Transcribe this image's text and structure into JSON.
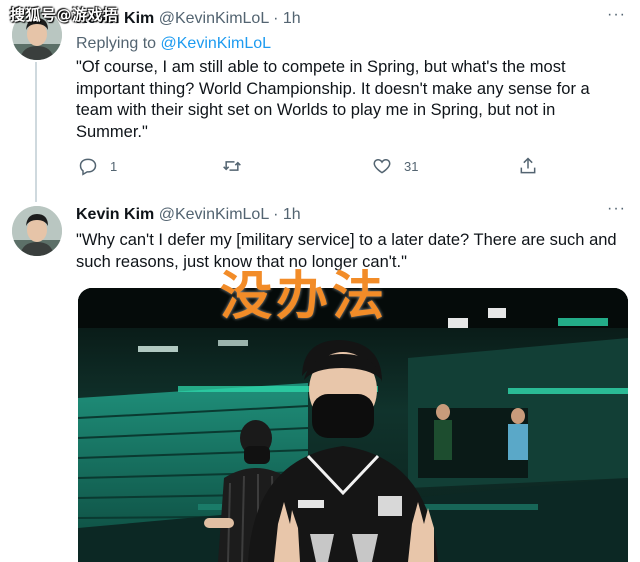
{
  "watermark": "搜狐号@游戏捂",
  "overlay_text": "没办法",
  "tweets": [
    {
      "name": "Kevin Kim",
      "handle": "@KevinKimLoL",
      "dot": "·",
      "time": "1h",
      "more": "···",
      "reply_prefix": "Replying to",
      "reply_mention": "@KevinKimLoL",
      "text": "\"Of course, I am still able to compete in Spring, but what's the most important thing? World Championship. It doesn't make any sense for a team with their sight set on Worlds to play me in Spring, but not in Summer.\"",
      "replies": "1",
      "retweets": "",
      "likes": "31"
    },
    {
      "name": "Kevin Kim",
      "handle": "@KevinKimLoL",
      "dot": "·",
      "time": "1h",
      "more": "···",
      "text": "\"Why can't I defer my [military service] to a later date? There are such and such reasons, just know that no longer can't.\""
    }
  ],
  "icons": {
    "reply": "reply-icon",
    "retweet": "retweet-icon",
    "like": "heart-icon",
    "share": "share-icon"
  },
  "colors": {
    "link": "#1d9bf0",
    "muted": "#536471",
    "overlay": "#f28c28",
    "arena_teal": "#1f8f7a"
  }
}
